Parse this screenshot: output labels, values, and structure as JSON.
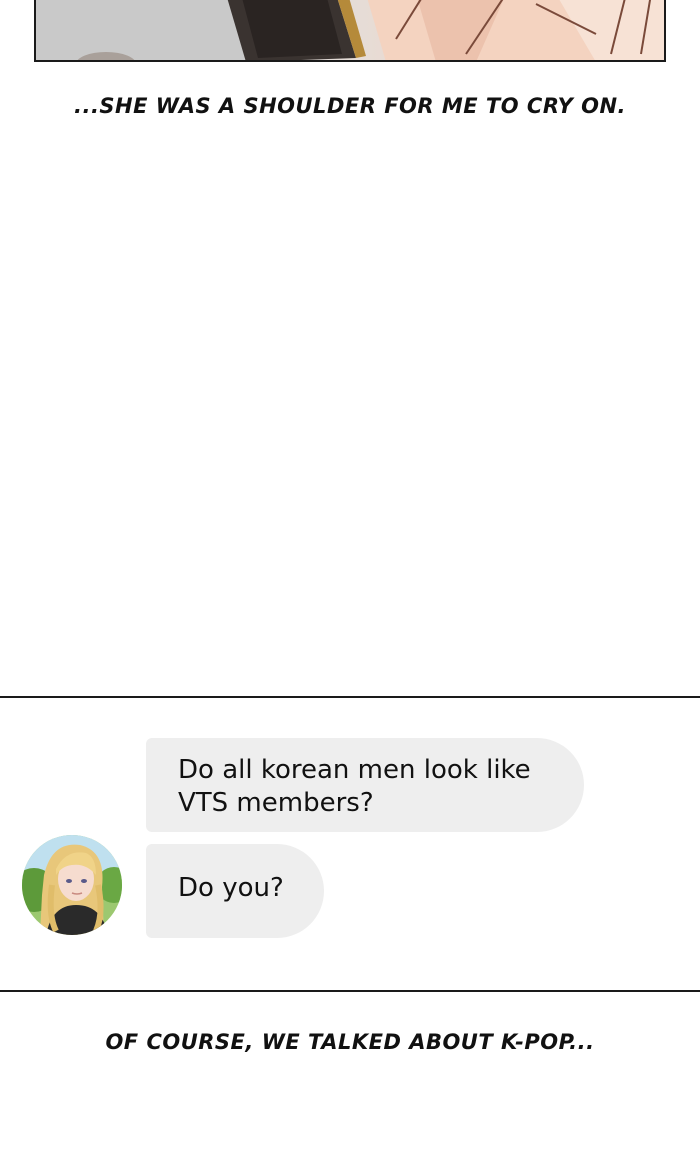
{
  "captions": {
    "top": "...SHE WAS A SHOULDER FOR ME TO CRY ON.",
    "bottom": "OF COURSE, WE TALKED ABOUT K-POP..."
  },
  "chat": {
    "messages": [
      {
        "text": "Do all korean men look like VTS members?"
      },
      {
        "text": "Do you?"
      }
    ],
    "avatar": {
      "icon": "blonde-woman-avatar"
    }
  },
  "colors": {
    "bubble": "#eeeeee",
    "text": "#111111",
    "border": "#1a1a1a"
  }
}
